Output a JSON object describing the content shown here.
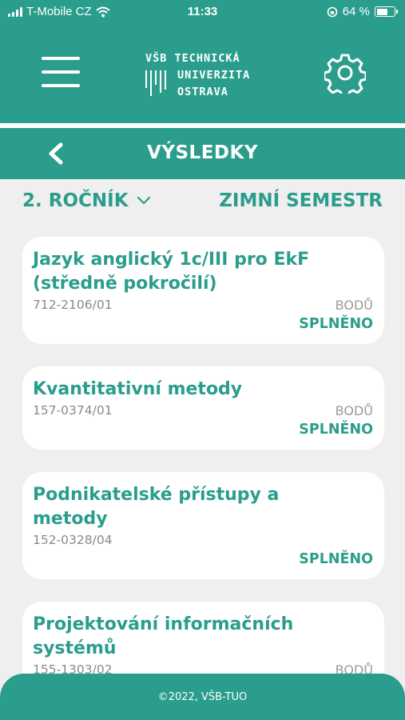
{
  "status_bar": {
    "carrier": "T-Mobile CZ",
    "time": "11:33",
    "battery_percent": "64 %",
    "battery_level": 0.64
  },
  "header": {
    "logo_line1": "VŠB TECHNICKÁ",
    "logo_line2": "UNIVERZITA",
    "logo_line3": "OSTRAVA",
    "menu_icon": "hamburger-icon",
    "settings_icon": "gear-icon"
  },
  "title_bar": {
    "title": "VÝSLEDKY",
    "back_icon": "chevron-left-icon"
  },
  "filters": {
    "year": "2. ROČNÍK",
    "semester": "ZIMNÍ SEMESTR"
  },
  "courses": [
    {
      "title": "Jazyk anglický 1c/III pro EkF (středně pokročilí)",
      "code": "712-2106/01",
      "points_label": "BODŮ",
      "status": "SPLNĚNO"
    },
    {
      "title": "Kvantitativní metody",
      "code": "157-0374/01",
      "points_label": "BODŮ",
      "status": "SPLNĚNO"
    },
    {
      "title": "Podnikatelské přístupy a metody",
      "code": "152-0328/04",
      "points_label": "",
      "status": "SPLNĚNO"
    },
    {
      "title": "Projektování informačních systémů",
      "code": "155-1303/02",
      "points_label": "BODŮ",
      "status": ""
    }
  ],
  "footer": {
    "copyright": "©2022, VŠB-TUO"
  },
  "colors": {
    "accent": "#2a9d8c",
    "background": "#efefef",
    "card": "#ffffff"
  }
}
